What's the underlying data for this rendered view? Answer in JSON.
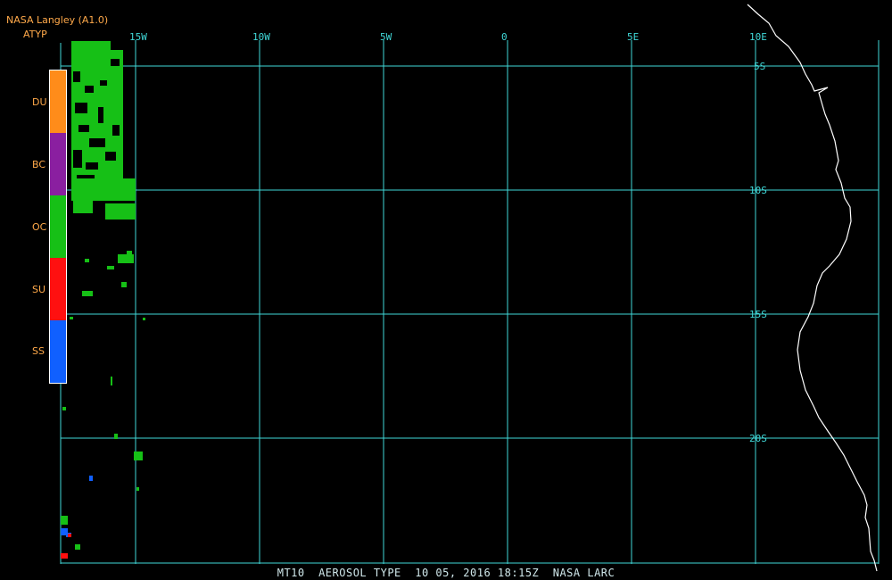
{
  "header": {
    "title": "NASA Langley (A1.0)",
    "product": "ATYP"
  },
  "legend": [
    {
      "code": "DU",
      "color": "#ff8c1a"
    },
    {
      "code": "BC",
      "color": "#8a1fa0"
    },
    {
      "code": "OC",
      "color": "#16c016"
    },
    {
      "code": "SU",
      "color": "#ff1010"
    },
    {
      "code": "SS",
      "color": "#1060ff"
    }
  ],
  "map": {
    "grid_color": "#40d8d8",
    "coast_color": "#ffffff",
    "longitude_labels": [
      "15W",
      "10W",
      "5W",
      "0",
      "5E",
      "10E"
    ],
    "latitude_labels": [
      "5S",
      "10S",
      "15S",
      "20S"
    ]
  },
  "footer": {
    "text": "MT10  AEROSOL TYPE  10 05, 2016 18:15Z  NASA LARC"
  }
}
